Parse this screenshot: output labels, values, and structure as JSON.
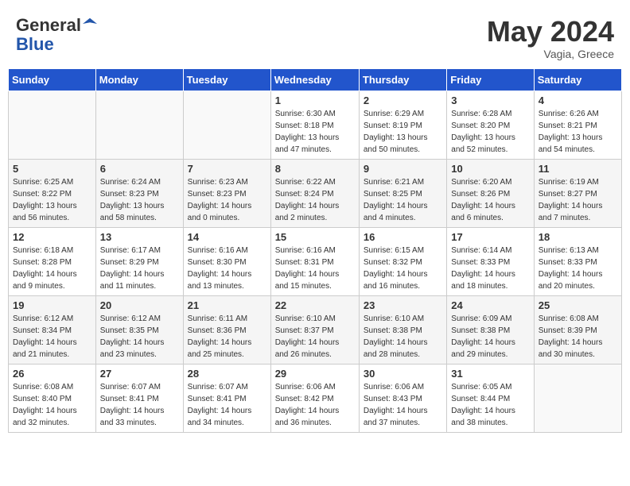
{
  "header": {
    "logo_line1": "General",
    "logo_line2": "Blue",
    "month_title": "May 2024",
    "location": "Vagia, Greece"
  },
  "days_of_week": [
    "Sunday",
    "Monday",
    "Tuesday",
    "Wednesday",
    "Thursday",
    "Friday",
    "Saturday"
  ],
  "weeks": [
    [
      {
        "num": "",
        "info": ""
      },
      {
        "num": "",
        "info": ""
      },
      {
        "num": "",
        "info": ""
      },
      {
        "num": "1",
        "info": "Sunrise: 6:30 AM\nSunset: 8:18 PM\nDaylight: 13 hours\nand 47 minutes."
      },
      {
        "num": "2",
        "info": "Sunrise: 6:29 AM\nSunset: 8:19 PM\nDaylight: 13 hours\nand 50 minutes."
      },
      {
        "num": "3",
        "info": "Sunrise: 6:28 AM\nSunset: 8:20 PM\nDaylight: 13 hours\nand 52 minutes."
      },
      {
        "num": "4",
        "info": "Sunrise: 6:26 AM\nSunset: 8:21 PM\nDaylight: 13 hours\nand 54 minutes."
      }
    ],
    [
      {
        "num": "5",
        "info": "Sunrise: 6:25 AM\nSunset: 8:22 PM\nDaylight: 13 hours\nand 56 minutes."
      },
      {
        "num": "6",
        "info": "Sunrise: 6:24 AM\nSunset: 8:23 PM\nDaylight: 13 hours\nand 58 minutes."
      },
      {
        "num": "7",
        "info": "Sunrise: 6:23 AM\nSunset: 8:23 PM\nDaylight: 14 hours\nand 0 minutes."
      },
      {
        "num": "8",
        "info": "Sunrise: 6:22 AM\nSunset: 8:24 PM\nDaylight: 14 hours\nand 2 minutes."
      },
      {
        "num": "9",
        "info": "Sunrise: 6:21 AM\nSunset: 8:25 PM\nDaylight: 14 hours\nand 4 minutes."
      },
      {
        "num": "10",
        "info": "Sunrise: 6:20 AM\nSunset: 8:26 PM\nDaylight: 14 hours\nand 6 minutes."
      },
      {
        "num": "11",
        "info": "Sunrise: 6:19 AM\nSunset: 8:27 PM\nDaylight: 14 hours\nand 7 minutes."
      }
    ],
    [
      {
        "num": "12",
        "info": "Sunrise: 6:18 AM\nSunset: 8:28 PM\nDaylight: 14 hours\nand 9 minutes."
      },
      {
        "num": "13",
        "info": "Sunrise: 6:17 AM\nSunset: 8:29 PM\nDaylight: 14 hours\nand 11 minutes."
      },
      {
        "num": "14",
        "info": "Sunrise: 6:16 AM\nSunset: 8:30 PM\nDaylight: 14 hours\nand 13 minutes."
      },
      {
        "num": "15",
        "info": "Sunrise: 6:16 AM\nSunset: 8:31 PM\nDaylight: 14 hours\nand 15 minutes."
      },
      {
        "num": "16",
        "info": "Sunrise: 6:15 AM\nSunset: 8:32 PM\nDaylight: 14 hours\nand 16 minutes."
      },
      {
        "num": "17",
        "info": "Sunrise: 6:14 AM\nSunset: 8:33 PM\nDaylight: 14 hours\nand 18 minutes."
      },
      {
        "num": "18",
        "info": "Sunrise: 6:13 AM\nSunset: 8:33 PM\nDaylight: 14 hours\nand 20 minutes."
      }
    ],
    [
      {
        "num": "19",
        "info": "Sunrise: 6:12 AM\nSunset: 8:34 PM\nDaylight: 14 hours\nand 21 minutes."
      },
      {
        "num": "20",
        "info": "Sunrise: 6:12 AM\nSunset: 8:35 PM\nDaylight: 14 hours\nand 23 minutes."
      },
      {
        "num": "21",
        "info": "Sunrise: 6:11 AM\nSunset: 8:36 PM\nDaylight: 14 hours\nand 25 minutes."
      },
      {
        "num": "22",
        "info": "Sunrise: 6:10 AM\nSunset: 8:37 PM\nDaylight: 14 hours\nand 26 minutes."
      },
      {
        "num": "23",
        "info": "Sunrise: 6:10 AM\nSunset: 8:38 PM\nDaylight: 14 hours\nand 28 minutes."
      },
      {
        "num": "24",
        "info": "Sunrise: 6:09 AM\nSunset: 8:38 PM\nDaylight: 14 hours\nand 29 minutes."
      },
      {
        "num": "25",
        "info": "Sunrise: 6:08 AM\nSunset: 8:39 PM\nDaylight: 14 hours\nand 30 minutes."
      }
    ],
    [
      {
        "num": "26",
        "info": "Sunrise: 6:08 AM\nSunset: 8:40 PM\nDaylight: 14 hours\nand 32 minutes."
      },
      {
        "num": "27",
        "info": "Sunrise: 6:07 AM\nSunset: 8:41 PM\nDaylight: 14 hours\nand 33 minutes."
      },
      {
        "num": "28",
        "info": "Sunrise: 6:07 AM\nSunset: 8:41 PM\nDaylight: 14 hours\nand 34 minutes."
      },
      {
        "num": "29",
        "info": "Sunrise: 6:06 AM\nSunset: 8:42 PM\nDaylight: 14 hours\nand 36 minutes."
      },
      {
        "num": "30",
        "info": "Sunrise: 6:06 AM\nSunset: 8:43 PM\nDaylight: 14 hours\nand 37 minutes."
      },
      {
        "num": "31",
        "info": "Sunrise: 6:05 AM\nSunset: 8:44 PM\nDaylight: 14 hours\nand 38 minutes."
      },
      {
        "num": "",
        "info": ""
      }
    ]
  ]
}
